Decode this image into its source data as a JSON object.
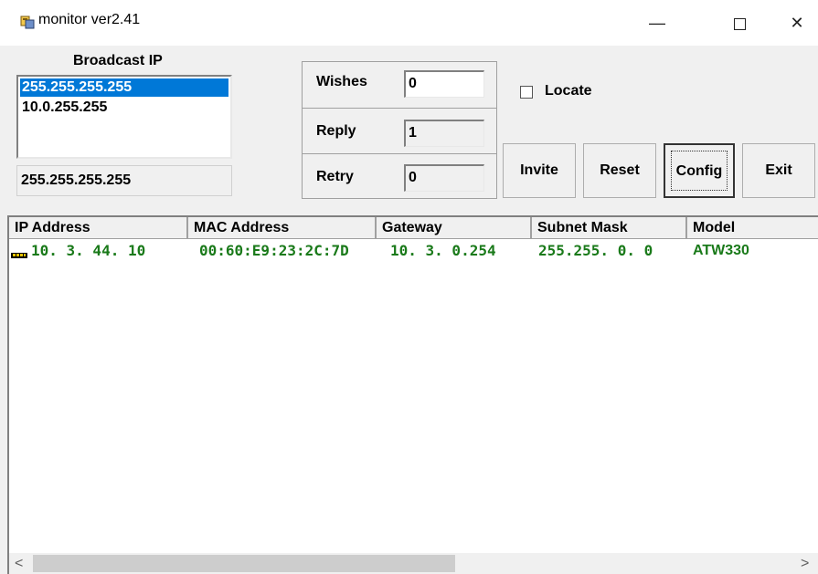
{
  "window": {
    "title": "monitor ver2.41",
    "minimize_glyph": "—",
    "close_glyph": "✕"
  },
  "broadcast": {
    "label": "Broadcast IP",
    "items": [
      "255.255.255.255",
      "10.0.255.255"
    ],
    "selected_value": "255.255.255.255"
  },
  "group": {
    "wishes": {
      "label": "Wishes",
      "value": "0"
    },
    "reply": {
      "label": "Reply",
      "value": "1"
    },
    "retry": {
      "label": "Retry",
      "value": "0"
    }
  },
  "locate": {
    "label": "Locate",
    "checked": false
  },
  "buttons": {
    "invite": "Invite",
    "reset": "Reset",
    "config": "Config",
    "exit": "Exit"
  },
  "table": {
    "columns": [
      "IP Address",
      "MAC Address",
      "Gateway",
      "Subnet Mask",
      "Model"
    ],
    "rows": [
      {
        "ip": "10. 3. 44. 10",
        "mac": "00:60:E9:23:2C:7D",
        "gateway": "10. 3. 0.254",
        "subnet": "255.255. 0. 0",
        "model": "ATW330"
      }
    ],
    "text_color": "#1a7a1a"
  },
  "scrollbar": {
    "left_glyph": "<",
    "right_glyph": ">"
  },
  "colors": {
    "selection": "#0078d7",
    "window_bg": "#f0f0f0"
  }
}
